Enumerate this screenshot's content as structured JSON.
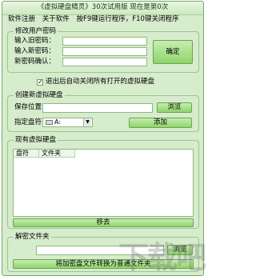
{
  "window": {
    "title": "《虚拟硬盘精灵》30次试用版 现在是第0次"
  },
  "menu": {
    "items": [
      "软件注册",
      "关于软件",
      "按F9键运行程序，F10键关闭程序"
    ]
  },
  "password": {
    "group_title": "修改用户密码",
    "old_label": "输入旧密码：",
    "new_label": "输入新密码：",
    "confirm_label": "新密码确认：",
    "confirm_button": "确定"
  },
  "auto_close": {
    "label": "退出后自动关闭所有打开的虚拟硬盘",
    "checked": true
  },
  "create": {
    "group_title": "创建新虚拟硬盘",
    "save_label": "保存位置",
    "browse_button": "浏览",
    "drive_label": "指定盘符",
    "drive_value": "A:",
    "add_button": "添加"
  },
  "existing": {
    "group_title": "现有虚拟硬盘",
    "columns": [
      "盘符",
      "文件夹"
    ],
    "remove_button": "移去"
  },
  "decrypt": {
    "group_title": "解密文件夹",
    "browse_button": "浏览",
    "convert_button": "将加密盘文件转换为普通文件夹"
  },
  "watermark": {
    "text": "下载吧"
  },
  "colors": {
    "panel": "#d6eccc",
    "button": "#8fd46b",
    "border": "#79a86a"
  }
}
